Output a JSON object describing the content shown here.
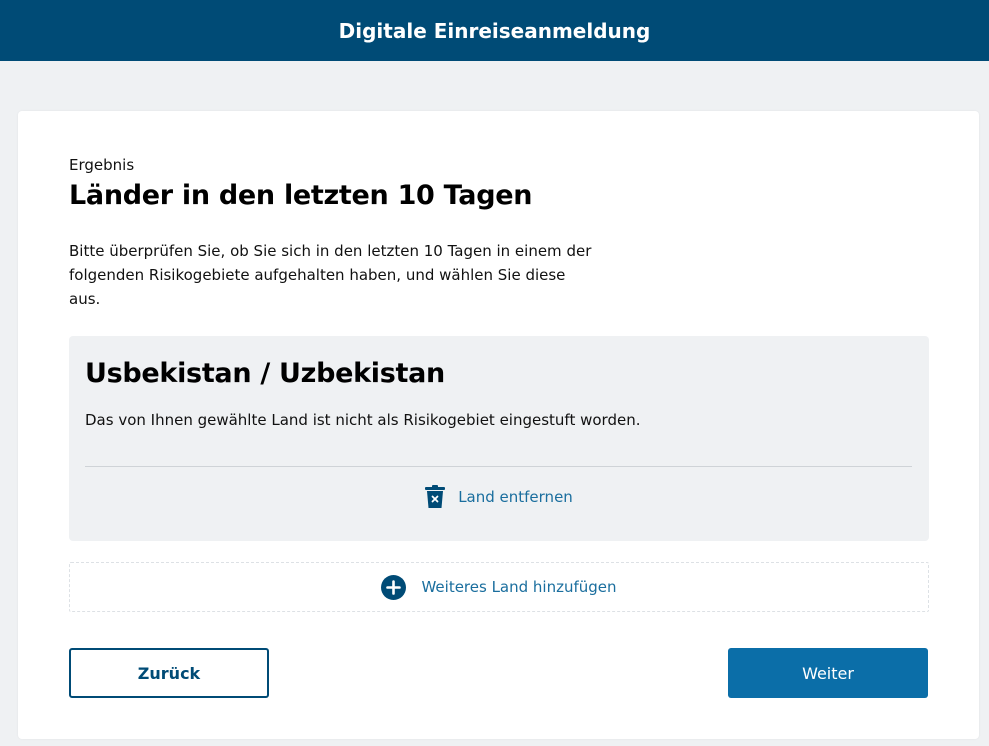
{
  "header": {
    "title": "Digitale Einreiseanmeldung"
  },
  "main": {
    "eyebrow": "Ergebnis",
    "title": "Länder in den letzten 10 Tagen",
    "intro": "Bitte überprüfen Sie, ob Sie sich in den letzten 10 Tagen in einem der folgenden Risikogebiete aufgehalten haben, und wählen Sie diese aus."
  },
  "country": {
    "name": "Usbekistan / Uzbekistan",
    "status": "Das von Ihnen gewählte Land ist nicht als Risikogebiet eingestuft worden.",
    "remove_label": "Land entfernen",
    "remove_icon": "trash-icon"
  },
  "add_country": {
    "label": "Weiteres Land hinzufügen",
    "icon": "plus-circle-icon"
  },
  "buttons": {
    "back_label": "Zurück",
    "next_label": "Weiter"
  },
  "colors": {
    "header_bg": "#004b76",
    "accent": "#0b6ea8",
    "link": "#1a6e9e",
    "page_bg": "#eff1f3"
  }
}
